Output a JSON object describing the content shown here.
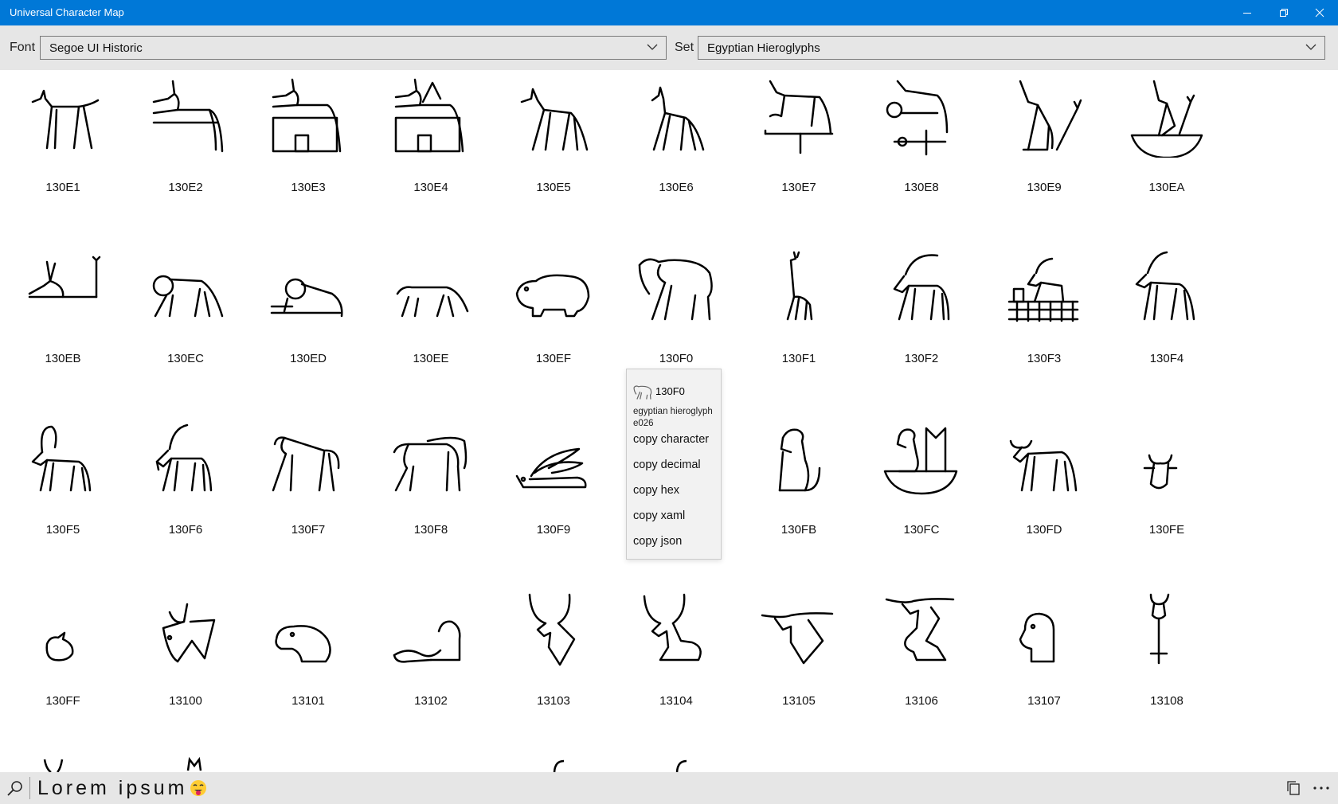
{
  "window": {
    "title": "Universal Character Map"
  },
  "toolbar": {
    "font_label": "Font",
    "font_value": "Segoe UI Historic",
    "set_label": "Set",
    "set_value": "Egyptian Hieroglyphs"
  },
  "grid": {
    "rows": [
      [
        "130E1",
        "130E2",
        "130E3",
        "130E4",
        "130E5",
        "130E6",
        "130E7",
        "130E8",
        "130E9",
        "130EA"
      ],
      [
        "130EB",
        "130EC",
        "130ED",
        "130EE",
        "130EF",
        "130F0",
        "130F1",
        "130F2",
        "130F3",
        "130F4"
      ],
      [
        "130F5",
        "130F6",
        "130F7",
        "130F8",
        "130F9",
        "",
        "130FB",
        "130FC",
        "130FD",
        "130FE"
      ],
      [
        "130FF",
        "13100",
        "13101",
        "13102",
        "13103",
        "13104",
        "13105",
        "13106",
        "13107",
        "13108"
      ]
    ]
  },
  "context_menu": {
    "code": "130F0",
    "description": "egyptian hieroglyph e026",
    "items": [
      "copy character",
      "copy decimal",
      "copy hex",
      "copy xaml",
      "copy json"
    ]
  },
  "status": {
    "text": "Lorem ipsum",
    "emoji_icon": "face-with-tongue-icon"
  },
  "colors": {
    "titlebar": "#0078d7",
    "toolbar": "#e6e6e6"
  }
}
